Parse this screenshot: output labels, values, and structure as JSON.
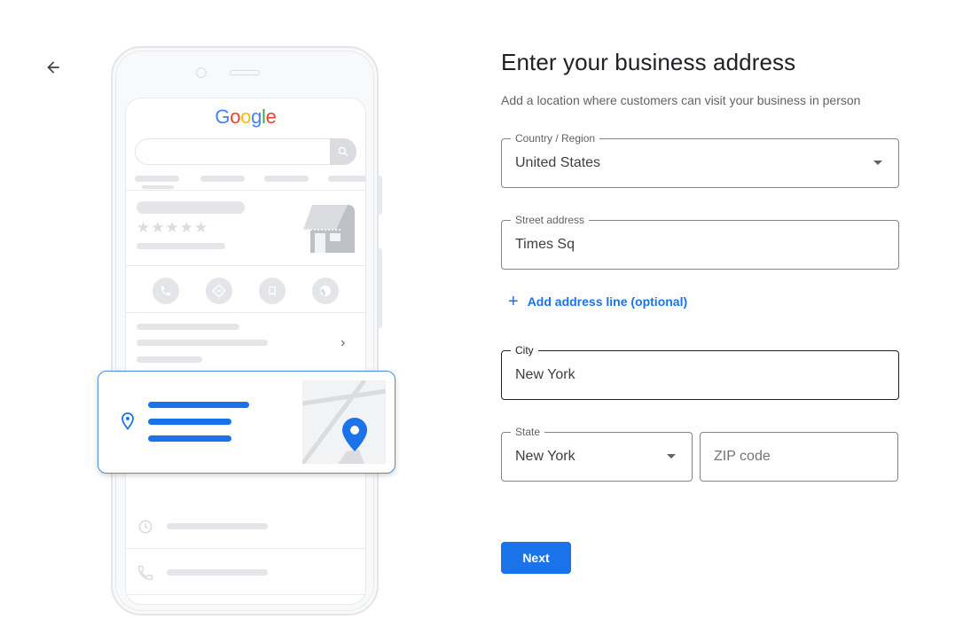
{
  "nav": {
    "back_icon": "arrow-left-icon"
  },
  "illustration": {
    "logo_letters": [
      {
        "ch": "G",
        "color": "#4285f4"
      },
      {
        "ch": "o",
        "color": "#ea4335"
      },
      {
        "ch": "o",
        "color": "#fbbc05"
      },
      {
        "ch": "g",
        "color": "#4285f4"
      },
      {
        "ch": "l",
        "color": "#34a853"
      },
      {
        "ch": "e",
        "color": "#ea4335"
      }
    ],
    "stars": "★★★★★",
    "chevron": "›",
    "accent_color": "#1a73e8"
  },
  "form": {
    "title": "Enter your business address",
    "subtitle": "Add a location where customers can visit your business in person",
    "country": {
      "label": "Country / Region",
      "value": "United States"
    },
    "street": {
      "label": "Street address",
      "value": "Times Sq"
    },
    "add_line": {
      "icon": "+",
      "label": "Add address line (optional)"
    },
    "city": {
      "label": "City",
      "value": "New York"
    },
    "state": {
      "label": "State",
      "value": "New York"
    },
    "zip": {
      "label": "",
      "value": "",
      "placeholder": "ZIP code"
    },
    "next_label": "Next"
  }
}
